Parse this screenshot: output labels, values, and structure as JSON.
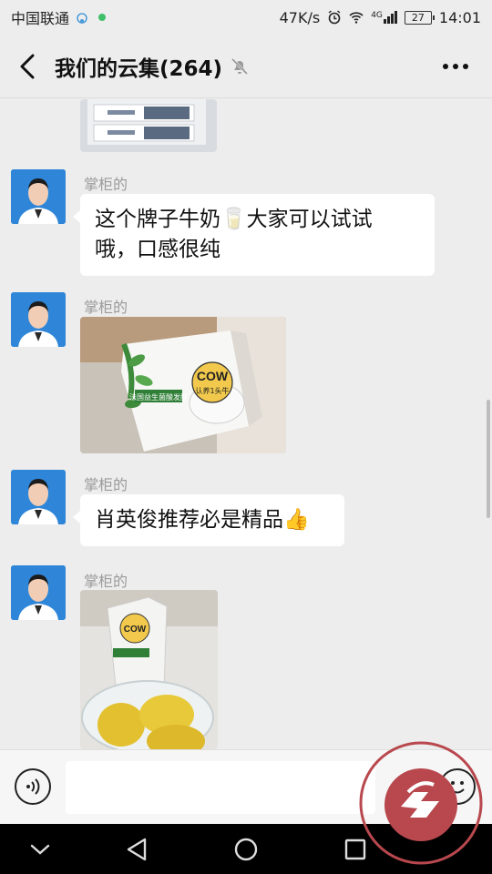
{
  "status_bar": {
    "carrier": "中国联通",
    "speed": "47K/s",
    "network": "4G",
    "battery": "27",
    "time": "14:01"
  },
  "header": {
    "title": "我们的云集(264)",
    "back_icon": "chevron-left-icon",
    "mute_icon": "bell-off-icon",
    "more_icon": "more-dots-icon"
  },
  "messages": [
    {
      "type": "image",
      "description_icon": "product-box-photo"
    },
    {
      "type": "text",
      "sender": "掌柜的",
      "text_line1": "这个牌子牛奶🥛大家可以试试",
      "text_line2": "哦，口感很纯"
    },
    {
      "type": "image",
      "sender": "掌柜的",
      "box_brand": "COW",
      "box_text": "法国益生菌酸发酵",
      "badge": "认养1头牛"
    },
    {
      "type": "text",
      "sender": "掌柜的",
      "text": "肖英俊推荐必是精品👍"
    },
    {
      "type": "image",
      "sender": "掌柜的",
      "box_brand": "COW"
    }
  ],
  "input_bar": {
    "value": "",
    "voice_icon": "voice-icon",
    "emoji_icon": "emoji-icon"
  },
  "nav_bar": {
    "icons": [
      "chevron-down-icon",
      "back-triangle-icon",
      "home-circle-icon",
      "recent-square-icon"
    ]
  },
  "colors": {
    "background": "#ededed",
    "bubble": "#ffffff",
    "nav": "#000000",
    "watermark": "#b8484e"
  }
}
